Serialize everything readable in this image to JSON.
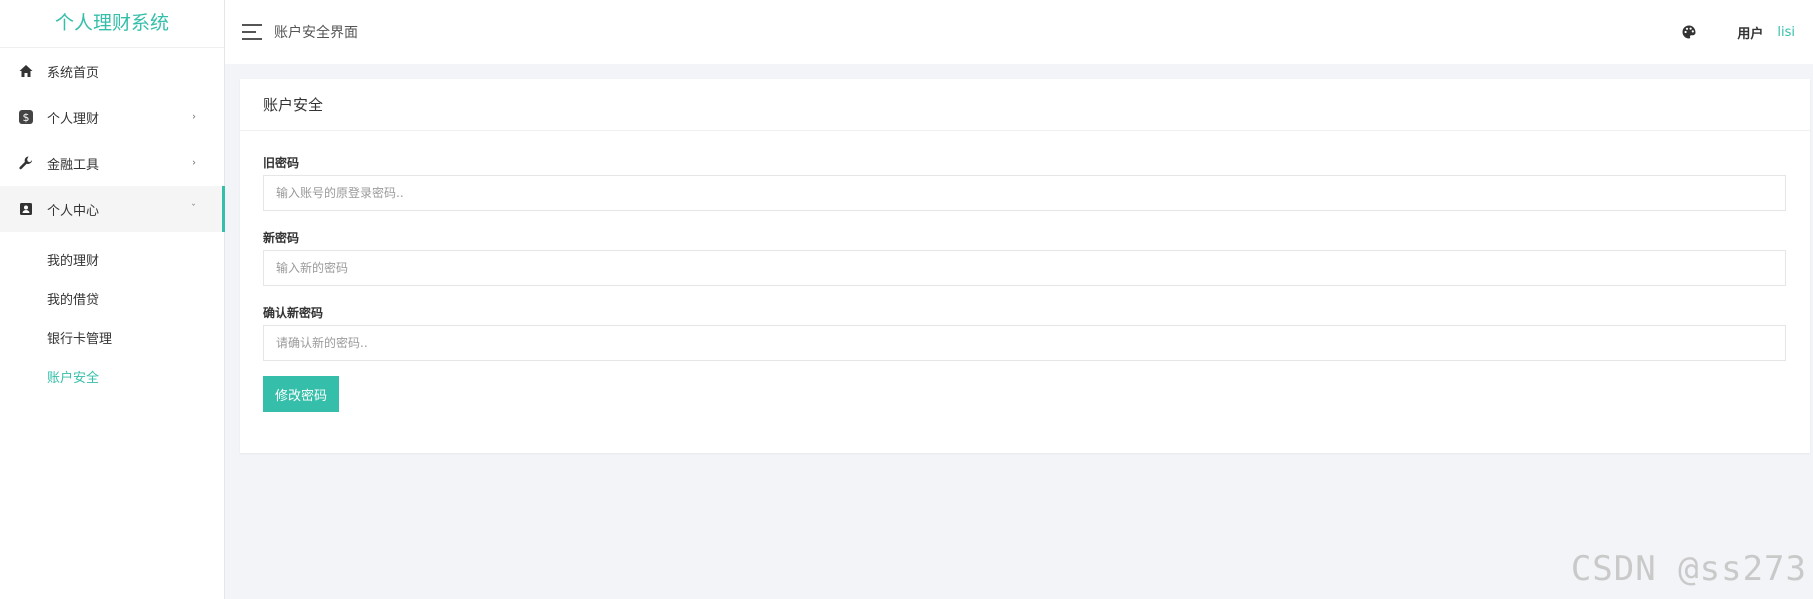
{
  "sidebar": {
    "brand": "个人理财系统",
    "items": [
      {
        "label": "系统首页",
        "icon": "home-icon"
      },
      {
        "label": "个人理财",
        "icon": "dollar-icon",
        "caret": "›"
      },
      {
        "label": "金融工具",
        "icon": "wrench-icon",
        "caret": "›"
      },
      {
        "label": "个人中心",
        "icon": "contact-card-icon",
        "caret": "ˇ"
      }
    ],
    "submenu": [
      {
        "label": "我的理财"
      },
      {
        "label": "我的借贷"
      },
      {
        "label": "银行卡管理"
      },
      {
        "label": "账户安全",
        "active": true
      }
    ]
  },
  "header": {
    "title": "账户安全界面",
    "user_label": "用户",
    "user_name": "lisi"
  },
  "card": {
    "title": "账户安全",
    "fields": [
      {
        "label": "旧密码",
        "placeholder": "输入账号的原登录密码.."
      },
      {
        "label": "新密码",
        "placeholder": "输入新的密码"
      },
      {
        "label": "确认新密码",
        "placeholder": "请确认新的密码.."
      }
    ],
    "submit_label": "修改密码"
  },
  "watermark": "CSDN @ss273",
  "colors": {
    "accent": "#35bfaa"
  }
}
